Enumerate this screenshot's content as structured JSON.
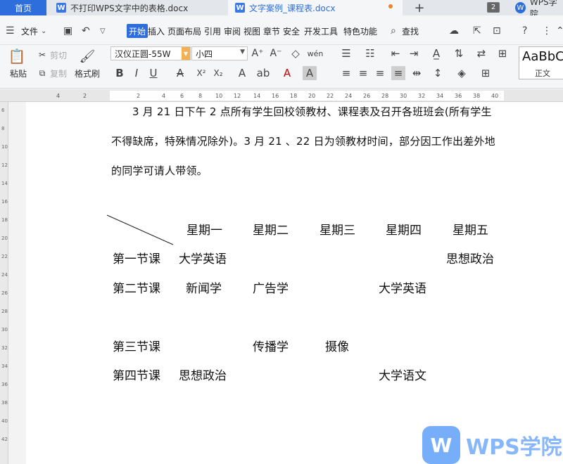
{
  "tabs": {
    "home": "首页",
    "doc1": "不打印WPS文字中的表格.docx",
    "doc2": "文字案例_课程表.docx",
    "count": "2",
    "account": "WPS学院"
  },
  "menu": {
    "file": "文件",
    "items": [
      "开始",
      "插入",
      "页面布局",
      "引用",
      "审阅",
      "视图",
      "章节",
      "安全",
      "开发工具",
      "特色功能"
    ],
    "search": "查找"
  },
  "ribbon": {
    "paste": "粘贴",
    "cut": "剪切",
    "copy": "复制",
    "format_painter": "格式刷",
    "font_name": "汉仪正圆-55W",
    "font_size": "小四",
    "style_preview": "AaBbC",
    "style_name": "正文"
  },
  "ruler": {
    "ticks": [
      "4",
      "2",
      "2",
      "4",
      "6",
      "8",
      "10",
      "12",
      "14",
      "16",
      "18",
      "20",
      "22",
      "24",
      "26",
      "28",
      "30",
      "32",
      "34",
      "36",
      "38",
      "40"
    ]
  },
  "document": {
    "para1": "3 月 21 日下午 2 点所有学生回校领教材、课程表及召开各班班会(所有学生",
    "para2": "不得缺席，特殊情况除外)。3 月 21 、22 日为领教材时间，部分因工作出差外地",
    "para3": "的同学可请人带领。",
    "days": [
      "星期一",
      "星期二",
      "星期三",
      "星期四",
      "星期五"
    ],
    "rows": [
      {
        "label": "第一节课",
        "mon": "大学英语",
        "fri": "思想政治"
      },
      {
        "label": "第二节课",
        "mon": "新闻学",
        "tue": "广告学",
        "thu": "大学英语"
      },
      {
        "label": "第三节课",
        "tue": "传播学",
        "wed": "摄像"
      },
      {
        "label": "第四节课",
        "mon": "思想政治",
        "thu": "大学语文"
      }
    ]
  },
  "watermark": {
    "text": "WPS学院",
    "logo_color": "#5fa0f8"
  }
}
